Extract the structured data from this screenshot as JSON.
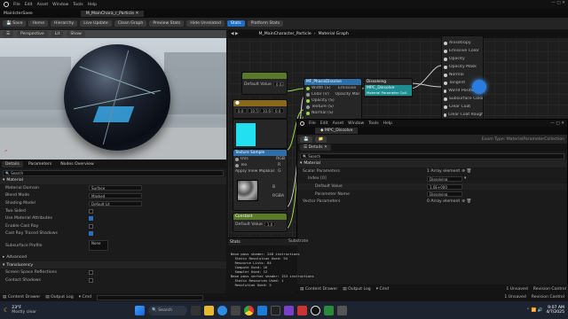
{
  "titlebar": {
    "project": "MainIcterSaee",
    "menus": [
      "File",
      "Edit",
      "Asset",
      "Window",
      "Tools",
      "Help"
    ],
    "tab": "M_MainChara_r_Particle"
  },
  "main_toolbar": {
    "items": [
      "Save",
      "Home",
      "Hierarchy",
      "Live Update",
      "Clean Graph",
      "Preview Stats",
      "Hide Unrelated",
      "Stats",
      "Platform Stats"
    ]
  },
  "viewport": {
    "perspective": "Perspective",
    "lit": "Lit",
    "show": "Show"
  },
  "graph": {
    "title": "M_MainCharacter_Particle",
    "breadcrumb": "Material Graph",
    "output_pins": [
      "Anisotropy",
      "Emissive Color",
      "Opacity",
      "Opacity Mask",
      "Normal",
      "Tangent",
      "World Position Offset",
      "Subsurface Color",
      "Clear Coat",
      "Clear Coat Roughness"
    ],
    "nodes": {
      "default_value_node": {
        "label": "Default Value",
        "value": "0.03"
      },
      "main_particle": {
        "title": "MF_PhasisDissolve",
        "inputs": [
          "Width (S)",
          "Color (V)",
          "Opacity (S)",
          "Texture (S)",
          "Normal (S)"
        ],
        "outputs": [
          "Emissive",
          "Opacity Mask"
        ]
      },
      "dissolving": {
        "title": "Dissolving",
        "sub": "MPC_Dissolve",
        "detail": "Material Parameter Coll."
      },
      "vector_node": {
        "values": [
          "0.0",
          "10.5",
          "10.6",
          "0.0"
        ]
      },
      "texture_sample": {
        "title": "Texture Sample",
        "pins": [
          "UVs",
          "Tex",
          "Apply View MipBias"
        ],
        "outputs": [
          "RGB",
          "R",
          "G",
          "B",
          "A",
          "RGBA"
        ]
      },
      "constant": {
        "title": "Constant",
        "label": "Default Value",
        "value": "1.0"
      }
    }
  },
  "details_left": {
    "tabs": [
      "Details",
      "Parameters",
      "Nodes Overview"
    ],
    "search_placeholder": "Search",
    "section": "Material",
    "rows": [
      {
        "k": "Material Domain",
        "v": "Surface"
      },
      {
        "k": "Blend Mode",
        "v": "Masked"
      },
      {
        "k": "Shading Model",
        "v": "Default Lit"
      },
      {
        "k": "Two Sided",
        "v": ""
      },
      {
        "k": "Use Material Attributes",
        "v": ""
      },
      {
        "k": "Enable Cast Ray",
        "v": ""
      },
      {
        "k": "Cast Ray Traced Shadows",
        "v": ""
      },
      {
        "k": "Subsurface Profile",
        "v": "None"
      }
    ],
    "advanced": "Advanced",
    "section2": "Translucency",
    "rows2": [
      {
        "k": "Screen Space Reflections",
        "v": ""
      },
      {
        "k": "Contact Shadows",
        "v": ""
      }
    ]
  },
  "mpc_window": {
    "menus": [
      "File",
      "Edit",
      "Asset",
      "Window",
      "Tools",
      "Help"
    ],
    "tab": "MPC_Dissolve",
    "panel": "Details",
    "search_placeholder": "Search",
    "section": "Material",
    "rows": [
      {
        "k": "Scalar Parameters",
        "v": "1 Array element"
      },
      {
        "k": "Index [0]",
        "v": "Dissolving"
      },
      {
        "k": "Default Value",
        "v": "1.0E+000"
      },
      {
        "k": "Parameter Name",
        "v": "Dissolving"
      },
      {
        "k": "Vector Parameters",
        "v": "0 Array element"
      }
    ],
    "breadcrumb_right": "Exam Type: MaterialParameterCollection"
  },
  "stats_panel": {
    "tabs": [
      "Stats",
      "Substrate"
    ],
    "lines": [
      "Base pass shader: 248 instructions",
      "  Static Resolution Used: 94",
      "  Resource Lists: 64",
      "  Compute Used: 16",
      "  Sampler Used: 12",
      "",
      "Base pass vertex shader: 153 instructions",
      "  Static Resources Used: 1",
      "  Resolution Used: 5"
    ]
  },
  "mpc_bottom": {
    "items": [
      "Content Drawer",
      "Output Log",
      "Cmd"
    ],
    "right": [
      "1 Unsaved",
      "Revision Control"
    ]
  },
  "main_bottom": {
    "items": [
      "Content Drawer",
      "Output Log",
      "Cmd"
    ],
    "right": [
      "1 Unsaved",
      "Revision Control"
    ]
  },
  "taskbar": {
    "weather": "23°F",
    "weather_sub": "Mostly clear",
    "search_placeholder": "Search",
    "time": "9:07 AM",
    "date": "4/7/2025"
  }
}
